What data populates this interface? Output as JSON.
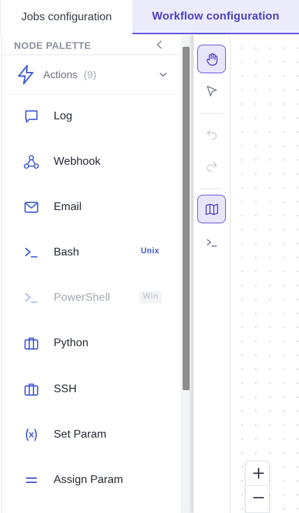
{
  "tabs": [
    {
      "label": "Jobs configuration",
      "active": false
    },
    {
      "label": "Workflow configuration",
      "active": true
    }
  ],
  "palette": {
    "title": "NODE PALETTE",
    "group": {
      "label": "Actions",
      "count": "(9)",
      "icon": "lightning-icon",
      "expanded": true
    },
    "nodes": [
      {
        "label": "Log",
        "icon": "message-square-icon",
        "badge": "",
        "disabled": false
      },
      {
        "label": "Webhook",
        "icon": "webhook-icon",
        "badge": "",
        "disabled": false
      },
      {
        "label": "Email",
        "icon": "envelope-icon",
        "badge": "",
        "disabled": false
      },
      {
        "label": "Bash",
        "icon": "terminal-icon",
        "badge": "Unix",
        "disabled": false
      },
      {
        "label": "PowerShell",
        "icon": "terminal-icon",
        "badge": "Win",
        "disabled": true
      },
      {
        "label": "Python",
        "icon": "briefcase-icon",
        "badge": "",
        "disabled": false
      },
      {
        "label": "SSH",
        "icon": "briefcase-icon",
        "badge": "",
        "disabled": false
      },
      {
        "label": "Set Param",
        "icon": "variable-icon",
        "badge": "",
        "disabled": false
      },
      {
        "label": "Assign Param",
        "icon": "equals-icon",
        "badge": "",
        "disabled": false
      }
    ]
  },
  "toolbar": {
    "tools": [
      "hand-icon",
      "pointer-icon",
      "undo-icon",
      "redo-icon",
      "map-icon",
      "terminal-icon"
    ],
    "active_tools": [
      "hand-icon",
      "map-icon"
    ]
  },
  "zoom": {
    "in_label": "+",
    "out_label": "−"
  },
  "colors": {
    "accent": "#5b4fe0",
    "icon_blue": "#3d5bd9",
    "tab_active_bg": "#ecebfb"
  }
}
